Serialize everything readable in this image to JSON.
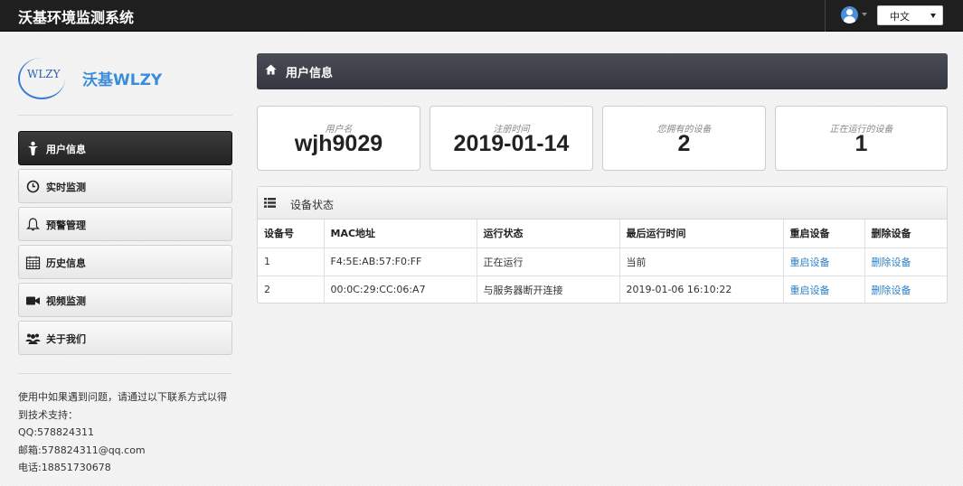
{
  "app": {
    "title": "沃基环境监测系统"
  },
  "topbar": {
    "language": "中文"
  },
  "logo": {
    "emblem_text": "WLZY",
    "name": "沃基WLZY"
  },
  "sidebar": {
    "items": [
      {
        "label": "用户信息",
        "icon": "user-icon",
        "active": true
      },
      {
        "label": "实时监测",
        "icon": "clock-icon",
        "active": false
      },
      {
        "label": "预警管理",
        "icon": "bell-icon",
        "active": false
      },
      {
        "label": "历史信息",
        "icon": "calendar-icon",
        "active": false
      },
      {
        "label": "视频监测",
        "icon": "video-camera-icon",
        "active": false
      },
      {
        "label": "关于我们",
        "icon": "group-icon",
        "active": false
      }
    ]
  },
  "contact": {
    "intro": "使用中如果遇到问题，请通过以下联系方式以得到技术支持：",
    "qq": "QQ:578824311",
    "email": "邮箱:578824311@qq.com",
    "phone": "电话:18851730678"
  },
  "page": {
    "title": "用户信息"
  },
  "stats": [
    {
      "label": "用户名",
      "value": "wjh9029"
    },
    {
      "label": "注册时间",
      "value": "2019-01-14"
    },
    {
      "label": "您拥有的设备",
      "value": "2"
    },
    {
      "label": "正在运行的设备",
      "value": "1"
    }
  ],
  "device_panel": {
    "title": "设备状态",
    "columns": [
      "设备号",
      "MAC地址",
      "运行状态",
      "最后运行时间",
      "重启设备",
      "删除设备"
    ],
    "rows": [
      {
        "id": "1",
        "mac": "F4:5E:AB:57:F0:FF",
        "status": "正在运行",
        "last_run": "当前",
        "restart": "重启设备",
        "delete": "删除设备"
      },
      {
        "id": "2",
        "mac": "00:0C:29:CC:06:A7",
        "status": "与服务器断开连接",
        "last_run": "2019-01-06 16:10:22",
        "restart": "重启设备",
        "delete": "删除设备"
      }
    ]
  },
  "colors": {
    "link": "#2a7fc7",
    "brand_blue": "#3a8ddb",
    "header_dark": "#34373f"
  }
}
